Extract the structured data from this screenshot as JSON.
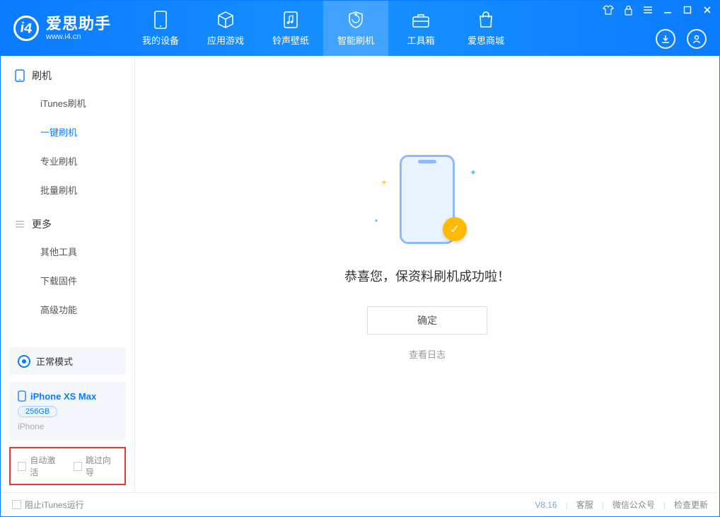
{
  "app": {
    "title": "爱思助手",
    "subtitle": "www.i4.cn"
  },
  "tabs": [
    {
      "label": "我的设备"
    },
    {
      "label": "应用游戏"
    },
    {
      "label": "铃声壁纸"
    },
    {
      "label": "智能刷机"
    },
    {
      "label": "工具箱"
    },
    {
      "label": "爱思商城"
    }
  ],
  "sidebar": {
    "section1_title": "刷机",
    "items1": [
      {
        "label": "iTunes刷机"
      },
      {
        "label": "一键刷机"
      },
      {
        "label": "专业刷机"
      },
      {
        "label": "批量刷机"
      }
    ],
    "section2_title": "更多",
    "items2": [
      {
        "label": "其他工具"
      },
      {
        "label": "下载固件"
      },
      {
        "label": "高级功能"
      }
    ]
  },
  "mode": {
    "label": "正常模式"
  },
  "device": {
    "name": "iPhone XS Max",
    "storage": "256GB",
    "type": "iPhone"
  },
  "options": {
    "auto_activate": "自动激活",
    "skip_guide": "跳过向导"
  },
  "main": {
    "success_text": "恭喜您，保资料刷机成功啦！",
    "ok_label": "确定",
    "log_link": "查看日志"
  },
  "footer": {
    "block_itunes": "阻止iTunes运行",
    "version": "V8.16",
    "support": "客服",
    "wechat": "微信公众号",
    "check_update": "检查更新"
  }
}
